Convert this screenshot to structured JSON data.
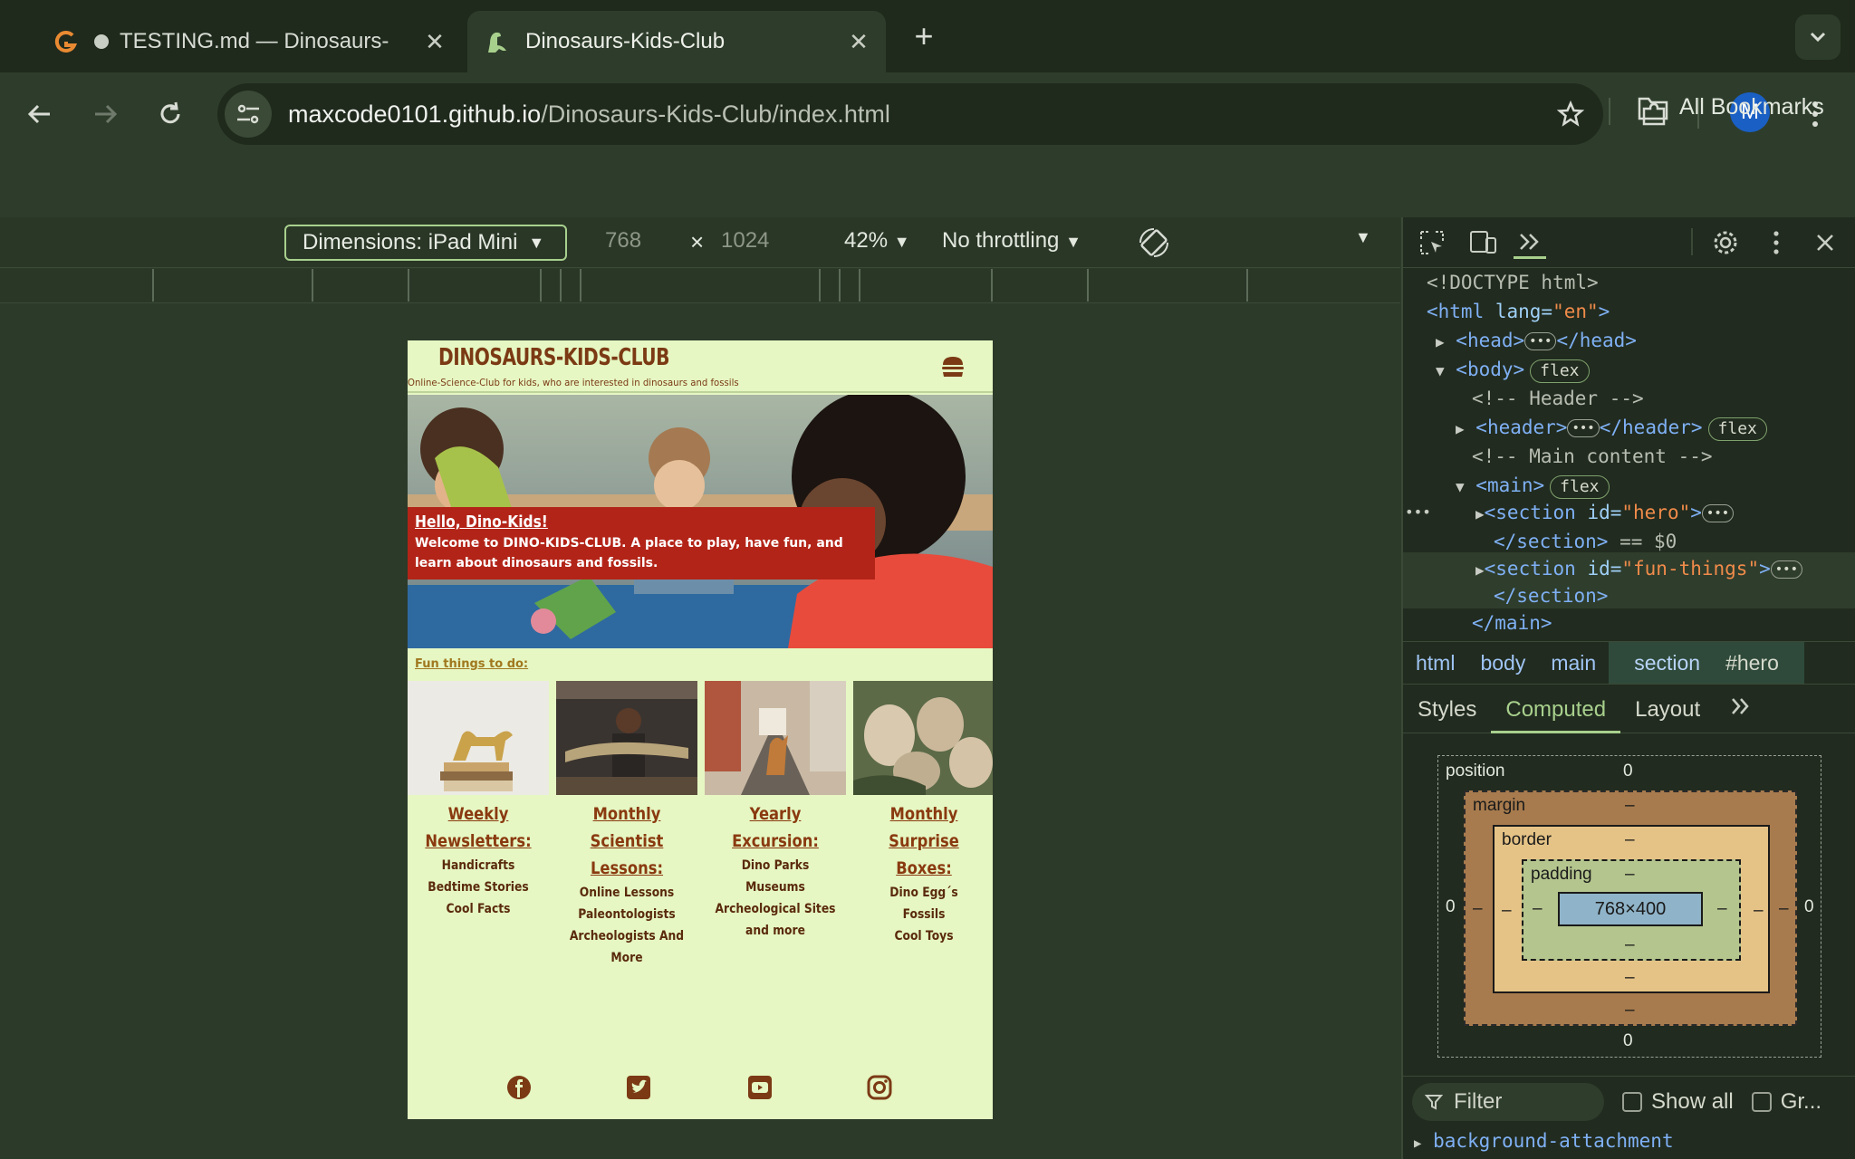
{
  "browser": {
    "tabs": [
      {
        "title": "TESTING.md — Dinosaurs-",
        "icon": "gitbook-icon",
        "active": false
      },
      {
        "title": "Dinosaurs-Kids-Club",
        "icon": "dinosaur-icon",
        "active": true
      }
    ],
    "url_host": "maxcode0101.github.io",
    "url_path": "/Dinosaurs-Kids-Club/index.html",
    "profile_initial": "M",
    "bookmarks_label": "All Bookmarks"
  },
  "device_toolbar": {
    "dimensions": "Dimensions: iPad Mini",
    "width": "768",
    "times": "×",
    "height": "1024",
    "zoom": "42%",
    "throttling": "No throttling"
  },
  "site": {
    "title": "DINOSAURS-KIDS-CLUB",
    "tagline": "Online-Science-Club for kids, who are interested in dinosaurs and fossils",
    "hero_heading": "Hello, Dino-Kids!",
    "hero_text": "Welcome to DINO-KIDS-CLUB. A place to play, have fun, and learn about dinosaurs and fossils.",
    "fun_label": "Fun things to do:",
    "cards": [
      {
        "title": "Weekly Newsletters:",
        "items": [
          "Handicrafts",
          "Bedtime Stories",
          "Cool Facts"
        ]
      },
      {
        "title": "Monthly Scientist Lessons:",
        "items": [
          "Online Lessons",
          "Paleontologists",
          "Archeologists And More"
        ]
      },
      {
        "title": "Yearly Excursion:",
        "items": [
          "Dino Parks",
          "Museums",
          "Archeological Sites and more"
        ]
      },
      {
        "title": "Monthly Surprise Boxes:",
        "items": [
          "Dino Egg´s",
          "Fossils",
          "Cool Toys"
        ]
      }
    ],
    "socials": [
      "facebook-icon",
      "twitter-icon",
      "youtube-icon",
      "instagram-icon"
    ]
  },
  "devtools": {
    "dom": {
      "doctype": "<!DOCTYPE html>",
      "html_open_tag": "<html ",
      "html_attr": "lang=",
      "html_val": "\"en\"",
      "html_close": ">",
      "head": "<head>",
      "head_close": "</head>",
      "body": "<body>",
      "flex": "flex",
      "comment_header": "<!-- Header -->",
      "header": "<header>",
      "header_close": "</header>",
      "comment_main": "<!-- Main content -->",
      "main": "<main>",
      "section_open": "<section ",
      "id_attr": "id=",
      "hero_val": "\"hero\"",
      "fun_val": "\"fun-things\"",
      "gt": ">",
      "section_close": "</section>",
      "selected_marker": "== $0",
      "main_close": "</main>"
    },
    "breadcrumbs": [
      "html",
      "body",
      "main",
      "section",
      "#hero"
    ],
    "subtabs": [
      "Styles",
      "Computed",
      "Layout"
    ],
    "box_model": {
      "position_label": "position",
      "margin_label": "margin",
      "border_label": "border",
      "padding_label": "padding",
      "content": "768×400",
      "zero": "0",
      "dash": "–"
    },
    "filter_placeholder": "Filter",
    "show_all": "Show all",
    "group": "Gr...",
    "first_property": "background-attachment"
  },
  "colors": {
    "site_bg": "#e6f7c3",
    "site_brown": "#7b3a14",
    "hero_red": "#b32418",
    "chrome_bg": "#2e3d2b"
  }
}
